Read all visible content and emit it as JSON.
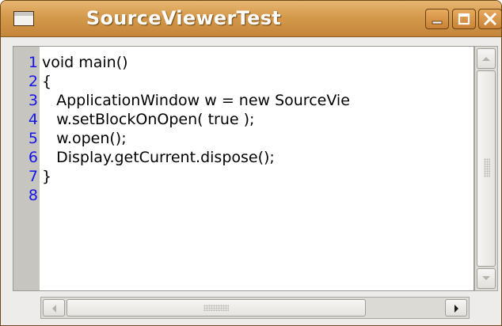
{
  "window": {
    "title": "SourceViewerTest",
    "titlebar_color": "#d49a4c",
    "controls": [
      "minimize-icon",
      "maximize-icon",
      "close-icon"
    ]
  },
  "editor": {
    "lines": [
      {
        "number": "1",
        "text": "void main()"
      },
      {
        "number": "2",
        "text": "{"
      },
      {
        "number": "3",
        "text": "   ApplicationWindow w = new SourceVie"
      },
      {
        "number": "4",
        "text": "   w.setBlockOnOpen( true );"
      },
      {
        "number": "5",
        "text": "   w.open();"
      },
      {
        "number": "6",
        "text": "   Display.getCurrent.dispose();"
      },
      {
        "number": "7",
        "text": "}"
      },
      {
        "number": "8",
        "text": ""
      }
    ],
    "line_number_color": "#1515e8"
  },
  "scrollbars": {
    "vertical": {
      "up_icon": "arrow-up-icon",
      "down_icon": "arrow-down-icon"
    },
    "horizontal": {
      "left_icon": "arrow-left-icon",
      "right_icon": "arrow-right-icon"
    }
  }
}
